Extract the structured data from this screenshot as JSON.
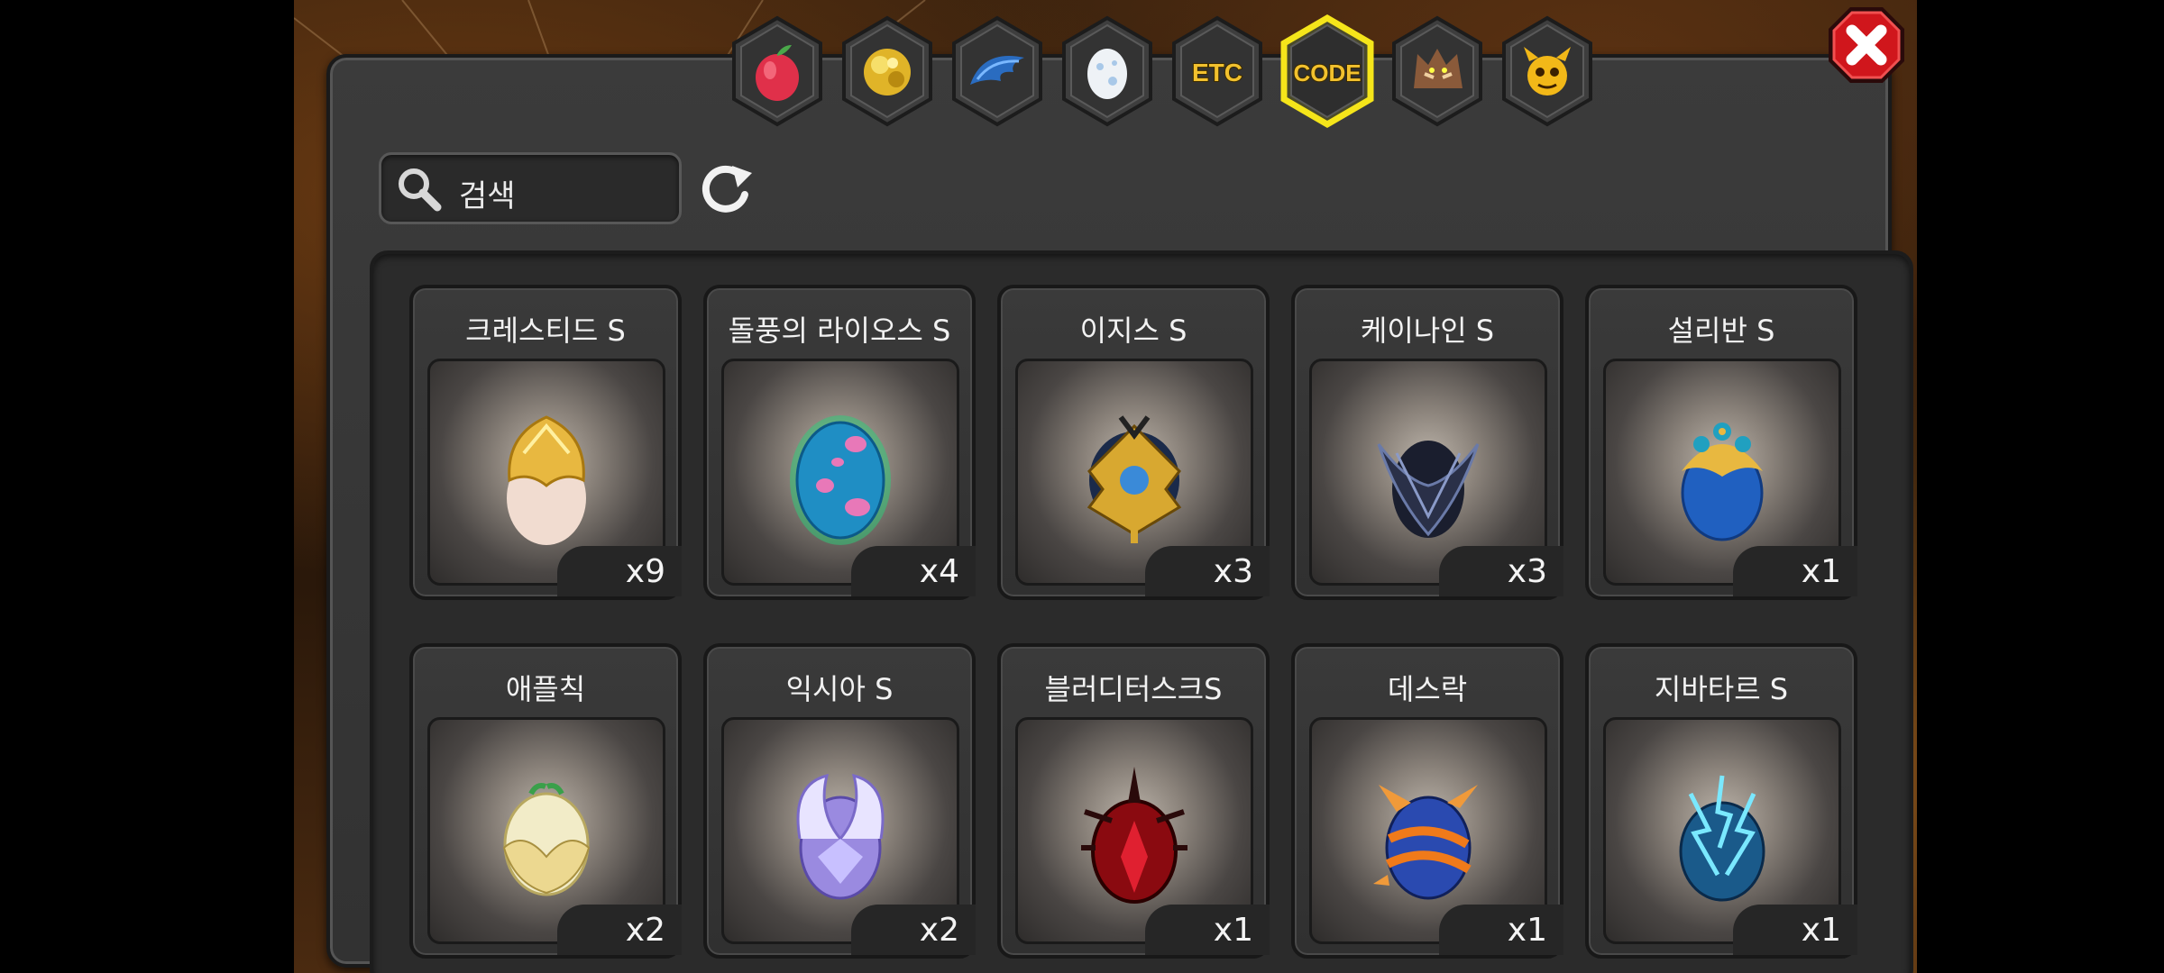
{
  "search": {
    "placeholder": "검색"
  },
  "tabs": [
    {
      "icon": "fruit-icon",
      "selected": false
    },
    {
      "icon": "gold-nugget-icon",
      "selected": false
    },
    {
      "icon": "blue-wing-icon",
      "selected": false
    },
    {
      "icon": "egg-icon",
      "selected": false
    },
    {
      "label": "ETC",
      "icon": "etc-icon",
      "selected": false
    },
    {
      "label": "CODE",
      "icon": "code-icon",
      "selected": true
    },
    {
      "icon": "wolf-icon",
      "selected": false
    },
    {
      "icon": "horned-face-icon",
      "selected": false
    }
  ],
  "items": [
    {
      "name": "크레스티드 S",
      "qty": "x9",
      "icon": "golden-crested-egg"
    },
    {
      "name": "돌풍의 라이오스 S",
      "qty": "x4",
      "icon": "blue-pink-spotted-egg"
    },
    {
      "name": "이지스 S",
      "qty": "x3",
      "icon": "gold-armored-egg"
    },
    {
      "name": "케이나인 S",
      "qty": "x3",
      "icon": "dark-spiked-egg"
    },
    {
      "name": "설리반 S",
      "qty": "x1",
      "icon": "peacock-egg"
    },
    {
      "name": "애플칙",
      "qty": "x2",
      "icon": "apple-chick-egg"
    },
    {
      "name": "익시아 S",
      "qty": "x2",
      "icon": "crystal-wing-egg"
    },
    {
      "name": "블러디터스크S",
      "qty": "x1",
      "icon": "red-spiked-egg"
    },
    {
      "name": "데스락",
      "qty": "x1",
      "icon": "horned-blue-orange-egg"
    },
    {
      "name": "지바타르 S",
      "qty": "x1",
      "icon": "lightning-egg"
    }
  ],
  "colors": {
    "tab_selected_border": "#f5e51a",
    "close_red": "#d0161c"
  }
}
